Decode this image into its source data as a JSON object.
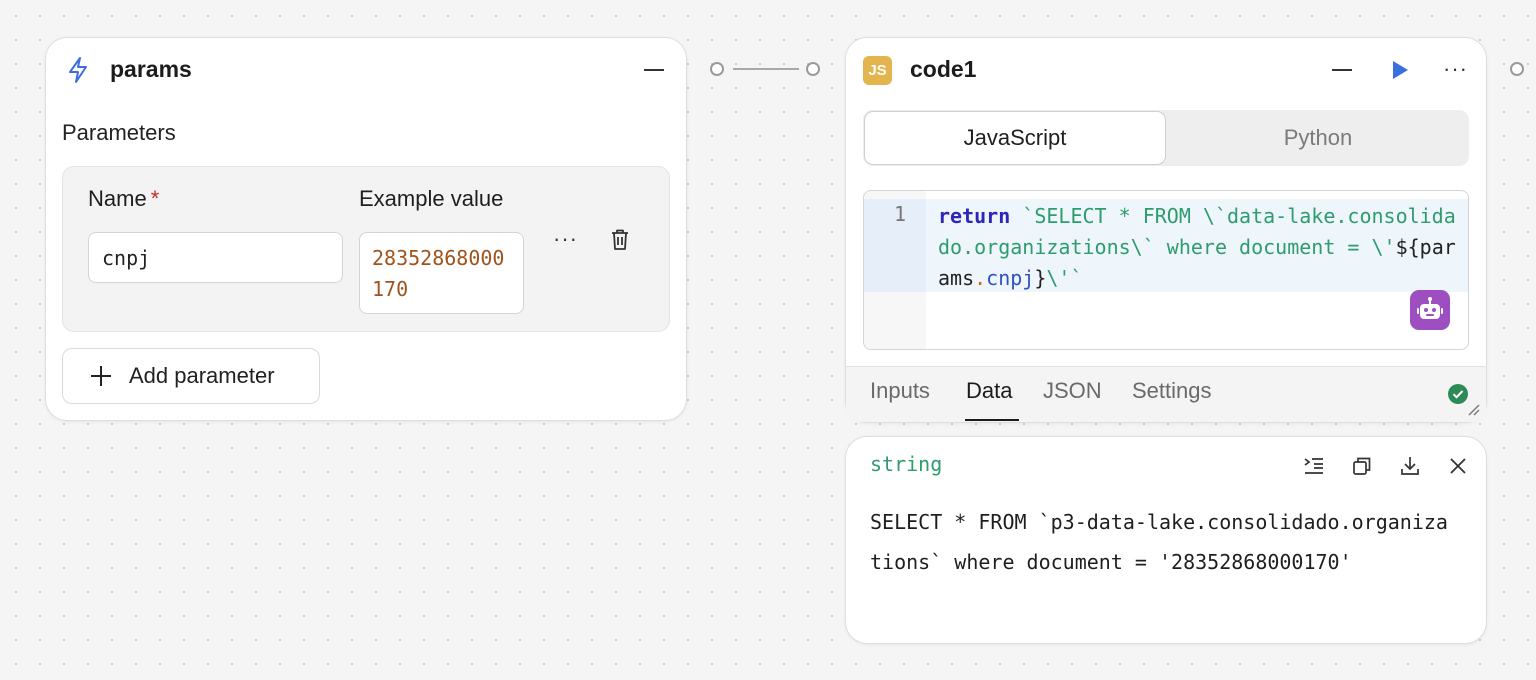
{
  "params_node": {
    "title": "params",
    "section_label": "Parameters",
    "name_label": "Name",
    "required_marker": "*",
    "example_label": "Example value",
    "name_value": "cnpj",
    "example_value": "28352868000170",
    "more_label": "···",
    "add_label": "Add parameter"
  },
  "code_node": {
    "badge": "JS",
    "title": "code1",
    "more_label": "···",
    "languages": [
      "JavaScript",
      "Python"
    ],
    "selected_language": "JavaScript",
    "line_number": "1",
    "code": {
      "keyword": "return",
      "template_part_1": " `SELECT * FROM \\`data-lake.consolidado.organizations\\` where document = \\'",
      "interp_open": "${",
      "interp_object": "params",
      "interp_dot": ".",
      "interp_property": "cnpj",
      "interp_close": "}",
      "template_part_2": "\\'`"
    },
    "tabs": [
      "Inputs",
      "Data",
      "JSON",
      "Settings"
    ],
    "active_tab": "Data"
  },
  "output": {
    "type": "string",
    "value": "SELECT * FROM `p3-data-lake.consolidado.organizations` where document = '28352868000170'"
  },
  "colors": {
    "accent_blue": "#3b6fe0",
    "string_green": "#2e9c6c",
    "keyword_purple": "#2e26b8",
    "example_orange": "#a0541d",
    "ai_purple": "#9d4fc2",
    "success_green": "#2e8b57"
  }
}
